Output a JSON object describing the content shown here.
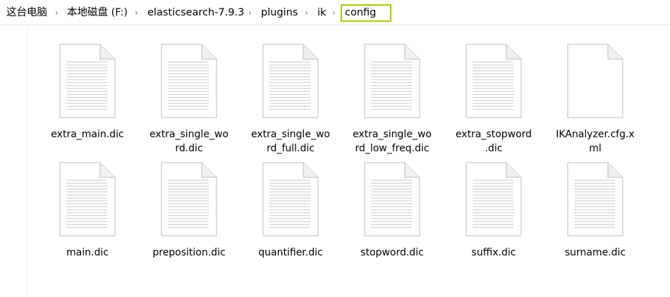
{
  "breadcrumb": {
    "items": [
      "这台电脑",
      "本地磁盘 (F:)",
      "elasticsearch-7.9.3",
      "plugins",
      "ik",
      "config"
    ]
  },
  "files": [
    {
      "name": "extra_main.dic",
      "line1": "extra_main.dic",
      "line2": "",
      "icon": "text-document-icon"
    },
    {
      "name": "extra_single_word.dic",
      "line1": "extra_single_wo",
      "line2": "rd.dic",
      "icon": "text-document-icon"
    },
    {
      "name": "extra_single_word_full.dic",
      "line1": "extra_single_wo",
      "line2": "rd_full.dic",
      "icon": "text-document-icon"
    },
    {
      "name": "extra_single_word_low_freq.dic",
      "line1": "extra_single_wo",
      "line2": "rd_low_freq.dic",
      "icon": "text-document-icon"
    },
    {
      "name": "extra_stopword.dic",
      "line1": "extra_stopword",
      "line2": ".dic",
      "icon": "text-document-icon"
    },
    {
      "name": "IKAnalyzer.cfg.xml",
      "line1": "IKAnalyzer.cfg.x",
      "line2": "ml",
      "icon": "blank-document-icon"
    },
    {
      "name": "main.dic",
      "line1": "main.dic",
      "line2": "",
      "icon": "text-document-icon"
    },
    {
      "name": "preposition.dic",
      "line1": "preposition.dic",
      "line2": "",
      "icon": "text-document-icon"
    },
    {
      "name": "quantifier.dic",
      "line1": "quantifier.dic",
      "line2": "",
      "icon": "text-document-icon"
    },
    {
      "name": "stopword.dic",
      "line1": "stopword.dic",
      "line2": "",
      "icon": "text-document-icon"
    },
    {
      "name": "suffix.dic",
      "line1": "suffix.dic",
      "line2": "",
      "icon": "text-document-icon"
    },
    {
      "name": "surname.dic",
      "line1": "surname.dic",
      "line2": "",
      "icon": "text-document-icon"
    }
  ],
  "colors": {
    "highlight": "#9ed000"
  }
}
